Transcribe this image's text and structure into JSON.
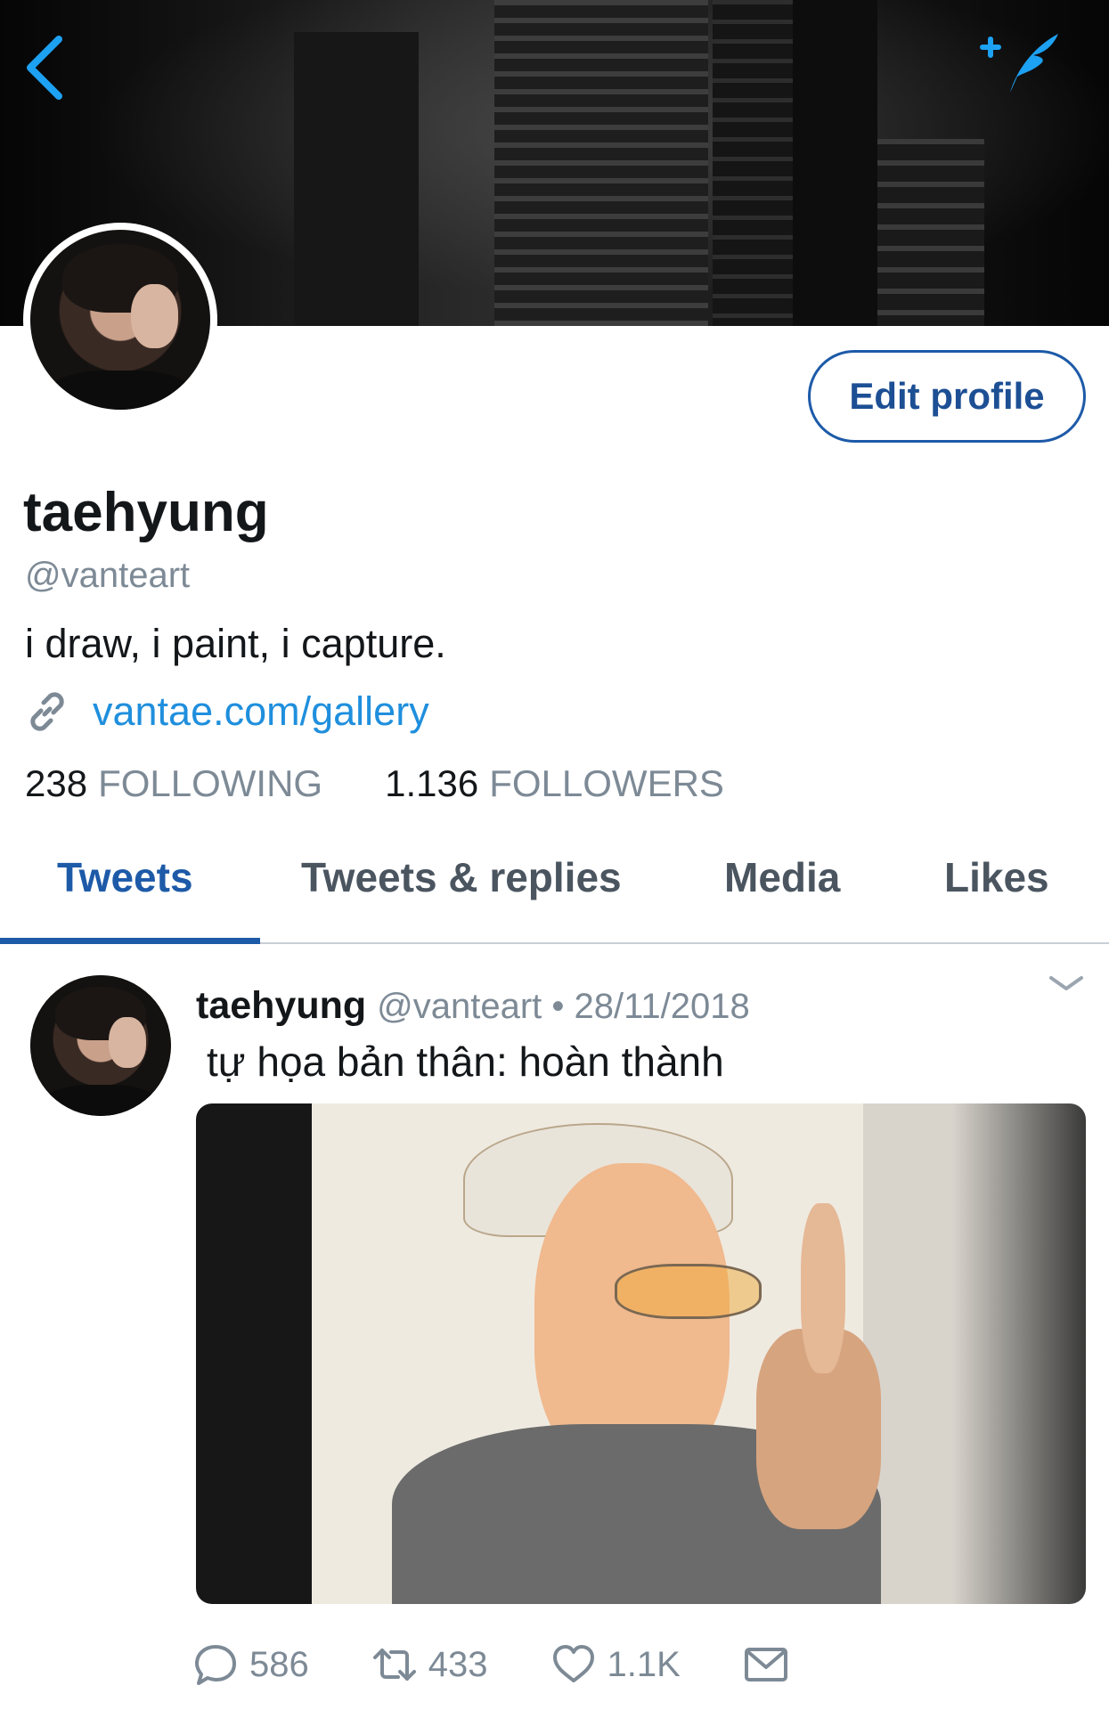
{
  "profile": {
    "name": "taehyung",
    "handle": "@vanteart",
    "bio": "i draw, i paint, i capture.",
    "link": "vantae.com/gallery",
    "following_count": "238",
    "following_label": "FOLLOWING",
    "followers_count": "1.136",
    "followers_label": "FOLLOWERS",
    "edit_label": "Edit profile"
  },
  "tabs": [
    {
      "label": "Tweets",
      "active": true
    },
    {
      "label": "Tweets & replies",
      "active": false
    },
    {
      "label": "Media",
      "active": false
    },
    {
      "label": "Likes",
      "active": false
    }
  ],
  "tweet": {
    "name": "taehyung",
    "meta": "@vanteart • 28/11/2018",
    "text": "tự họa bản thân: hoàn thành",
    "replies": "586",
    "retweets": "433",
    "likes": "1.1K"
  },
  "colors": {
    "accent": "#1d5aa8",
    "link": "#1f8fdd",
    "muted": "#7d8a96",
    "banner": "#111111"
  },
  "icons": [
    "back-icon",
    "compose-tweet-icon",
    "link-icon",
    "chevron-down-icon",
    "reply-icon",
    "retweet-icon",
    "like-icon",
    "message-icon"
  ]
}
